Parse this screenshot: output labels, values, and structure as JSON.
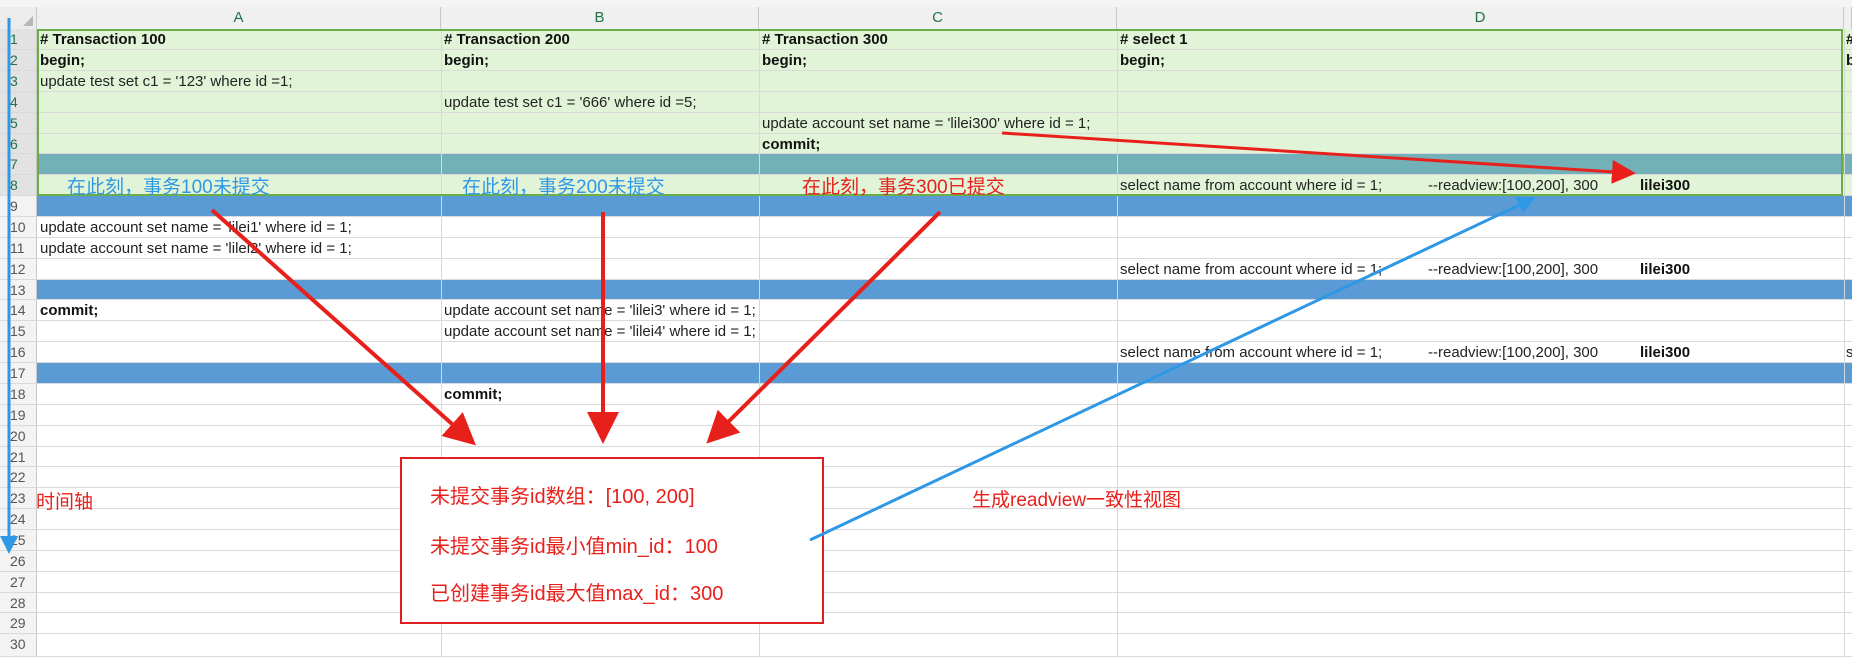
{
  "columns": [
    {
      "label": "A"
    },
    {
      "label": "B"
    },
    {
      "label": "C"
    },
    {
      "label": "D"
    }
  ],
  "row_numbers": [
    "1",
    "2",
    "3",
    "4",
    "5",
    "6",
    "7",
    "8",
    "9",
    "10",
    "11",
    "12",
    "13",
    "14",
    "15",
    "16",
    "17",
    "18",
    "19",
    "20",
    "21",
    "22",
    "23",
    "24",
    "25",
    "26",
    "27",
    "28",
    "29",
    "30"
  ],
  "cells": {
    "a1": "# Transaction 100",
    "b1": "# Transaction 200",
    "c1": "# Transaction 300",
    "d1": "# select 1",
    "e1": "#",
    "a2": "begin;",
    "b2": "begin;",
    "c2": "begin;",
    "d2": "begin;",
    "e2": "b",
    "a3": "update test set c1 = '123' where id =1;",
    "b4": "update test set c1 = '666' where id =5;",
    "c5": "update account set name = 'lilei300' where id = 1;",
    "c6": "commit;",
    "d8": "select name from account where id = 1;",
    "d8_comment": "--readview:[100,200], 300",
    "d8_result": "lilei300",
    "a10": "update account set name = 'lilei1' where id = 1;",
    "a11": "update account set name = 'lilei2' where id = 1;",
    "d12": "select name from account where id = 1;",
    "d12_comment": "--readview:[100,200], 300",
    "d12_result": "lilei300",
    "a14": "commit;",
    "b14": "update account set name = 'lilei3' where id = 1;",
    "b15": "update account set name = 'lilei4' where id = 1;",
    "d16": "select name from account where id = 1;",
    "d16_comment": "--readview:[100,200], 300",
    "d16_result": "lilei300",
    "e16": "s",
    "b18": "commit;"
  },
  "annotations": {
    "note_tx100": "在此刻，事务100未提交",
    "note_tx200": "在此刻，事务200未提交",
    "note_tx300": "在此刻，事务300已提交",
    "timeline": "时间轴",
    "readview": "生成readview一致性视图",
    "info_uncommitted": "未提交事务id数组：[100, 200]",
    "info_min_id": "未提交事务id最小值min_id：100",
    "info_max_id": "已创建事务id最大值max_id：300"
  },
  "colors": {
    "selection_fill": "#e2f4d7",
    "selection_border": "#6cae46",
    "band_blue": "#5b9bd5",
    "band_teal": "#72b1b8",
    "annotation_red": "#e8201b",
    "annotation_blue": "#2e98e6"
  }
}
